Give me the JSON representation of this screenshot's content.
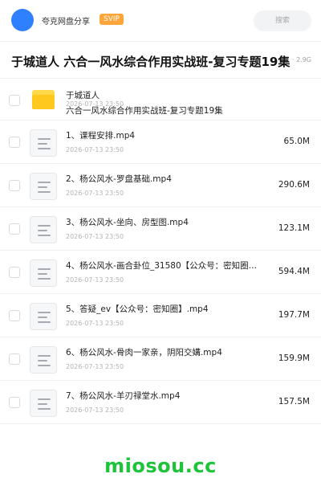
{
  "header": {
    "user_name": "夸克网盘分享",
    "badge": "SVIP",
    "search_placeholder": "搜索"
  },
  "title_bar": {
    "title": "于城道人 六合一风水综合作用实战班-复习专题19集",
    "meta": "· 2.9G"
  },
  "folder": {
    "name_line1": "于城道人",
    "date": "2026-07-13 23:50",
    "name_line2": "六合一风水综合作用实战班-复习专题19集",
    "icon": "folder-icon"
  },
  "files": [
    {
      "name": "1、课程安排.mp4",
      "date": "2026-07-13 23:50",
      "size": "65.0M",
      "icon": "file-icon"
    },
    {
      "name": "2、杨公风水-罗盘基础.mp4",
      "date": "2026-07-13 23:50",
      "size": "290.6M",
      "icon": "file-icon"
    },
    {
      "name": "3、杨公风水-坐向、房型图.mp4",
      "date": "2026-07-13 23:50",
      "size": "123.1M",
      "icon": "file-icon"
    },
    {
      "name": "4、杨公风水-画合卦位_31580【公众号：密知圈…",
      "date": "2026-07-13 23:50",
      "size": "594.4M",
      "icon": "file-icon"
    },
    {
      "name": "5、答疑_ev【公众号：密知圈】.mp4",
      "date": "2026-07-13 23:50",
      "size": "197.7M",
      "icon": "file-icon"
    },
    {
      "name": "6、杨公风水-骨肉一家亲，阴阳交媾.mp4",
      "date": "2026-07-13 23:50",
      "size": "159.9M",
      "icon": "file-icon"
    },
    {
      "name": "7、杨公风水-羊刃禄堂水.mp4",
      "date": "2026-07-13 23:50",
      "size": "157.5M",
      "icon": "file-icon"
    }
  ],
  "watermark": "miosou.cc",
  "colors": {
    "accent": "#2f80ff",
    "badge": "#ffa53a",
    "folder": "#ffc81e",
    "watermark": "#1dc339"
  }
}
